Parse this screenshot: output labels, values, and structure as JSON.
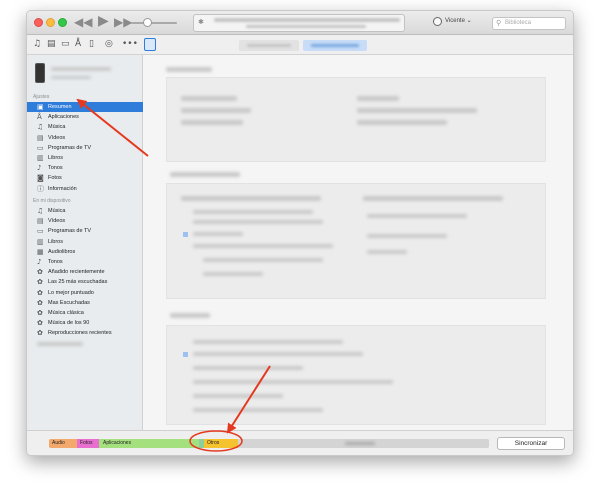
{
  "account": {
    "name": "Vicente ⌄"
  },
  "search": {
    "placeholder": "Biblioteca"
  },
  "sidebar": {
    "section_settings": "Ajustes",
    "settings_items": [
      {
        "label": "Resumen",
        "icon": "summary-icon"
      },
      {
        "label": "Aplicaciones",
        "icon": "apps-icon"
      },
      {
        "label": "Música",
        "icon": "music-note-icon"
      },
      {
        "label": "Vídeos",
        "icon": "film-icon"
      },
      {
        "label": "Programas de TV",
        "icon": "tv-icon"
      },
      {
        "label": "Libros",
        "icon": "book-icon"
      },
      {
        "label": "Tonos",
        "icon": "bell-icon"
      },
      {
        "label": "Fotos",
        "icon": "camera-icon"
      },
      {
        "label": "Información",
        "icon": "info-icon"
      }
    ],
    "section_device": "En mi dispositivo",
    "device_items": [
      {
        "label": "Música",
        "icon": "music-note-icon"
      },
      {
        "label": "Vídeos",
        "icon": "film-icon"
      },
      {
        "label": "Programas de TV",
        "icon": "tv-icon"
      },
      {
        "label": "Libros",
        "icon": "book-icon"
      },
      {
        "label": "Audiolibros",
        "icon": "audiobook-icon"
      },
      {
        "label": "Tonos",
        "icon": "bell-icon"
      },
      {
        "label": "Añadido recientemente",
        "icon": "gear-icon"
      },
      {
        "label": "Las 25 más escuchadas",
        "icon": "gear-icon"
      },
      {
        "label": "Lo mejor puntuado",
        "icon": "gear-icon"
      },
      {
        "label": "Mas Escuchadas",
        "icon": "gear-icon"
      },
      {
        "label": "Música clásica",
        "icon": "gear-icon"
      },
      {
        "label": "Música de los 90",
        "icon": "gear-icon"
      },
      {
        "label": "Reproducciones recientes",
        "icon": "gear-icon"
      }
    ]
  },
  "storage": {
    "segments": [
      {
        "label": "Audio",
        "color": "#f3a96b"
      },
      {
        "label": "Fotos",
        "color": "#e86fd0"
      },
      {
        "label": "Aplicaciones",
        "color": "#a5e07e"
      },
      {
        "label": "Otros",
        "color": "#f5c230"
      }
    ]
  },
  "sync_button": "Sincronizar",
  "colors": {
    "accent": "#2f7ddb",
    "arrow": "#e5391f"
  }
}
